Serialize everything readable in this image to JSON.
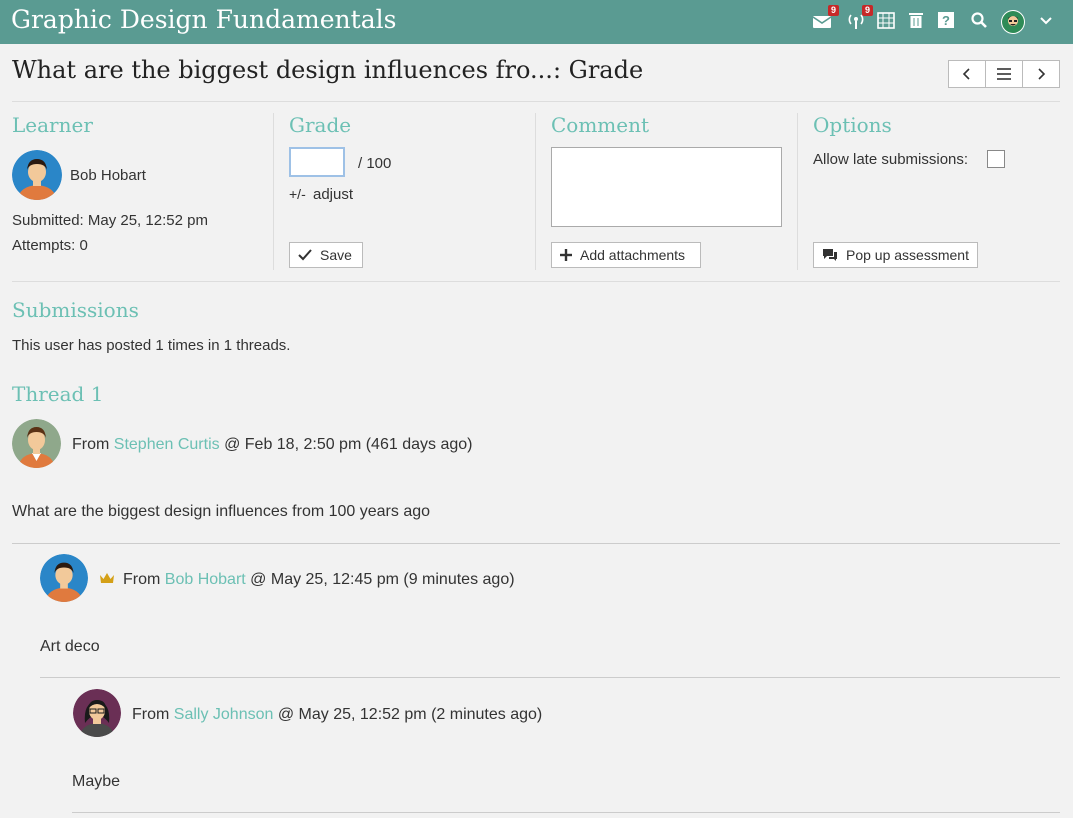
{
  "app": {
    "title": "Graphic Design Fundamentals"
  },
  "topbar": {
    "icons": [
      {
        "name": "mail-icon",
        "badge": "9"
      },
      {
        "name": "broadcast-icon",
        "badge": "9"
      },
      {
        "name": "calendar-icon"
      },
      {
        "name": "trash-icon"
      },
      {
        "name": "help-icon"
      },
      {
        "name": "search-icon"
      },
      {
        "name": "user-avatar"
      },
      {
        "name": "chevron-down-icon"
      }
    ]
  },
  "page": {
    "title": "What are the biggest design influences fro...: Grade"
  },
  "learner": {
    "heading": "Learner",
    "name": "Bob Hobart",
    "submitted": "Submitted: May 25, 12:52 pm",
    "attempts": "Attempts: 0"
  },
  "grade": {
    "heading": "Grade",
    "value": "",
    "max": "/ 100",
    "adjust_prefix": "+/-",
    "adjust_label": "adjust",
    "save_label": "Save"
  },
  "comment": {
    "heading": "Comment",
    "value": "",
    "attach_label": "Add attachments"
  },
  "options": {
    "heading": "Options",
    "late_label": "Allow late submissions:",
    "late_checked": false,
    "popup_label": "Pop up assessment"
  },
  "submissions": {
    "heading": "Submissions",
    "summary": "This user has posted 1 times in 1 threads."
  },
  "thread": {
    "heading": "Thread 1",
    "posts": [
      {
        "from_prefix": "From",
        "author": "Stephen Curtis",
        "meta": "@ Feb 18, 2:50 pm (461 days ago)",
        "body": "What are the biggest design influences from 100 years ago"
      },
      {
        "from_prefix": "From",
        "author": "Bob Hobart",
        "meta": "@ May 25, 12:45 pm (9 minutes ago)",
        "body": "Art deco"
      },
      {
        "from_prefix": "From",
        "author": "Sally Johnson",
        "meta": "@ May 25, 12:52 pm (2 minutes ago)",
        "body": "Maybe"
      }
    ]
  },
  "colors": {
    "topbar": "#5a9b92",
    "accent": "#6cc0b4",
    "badge": "#c62828"
  }
}
